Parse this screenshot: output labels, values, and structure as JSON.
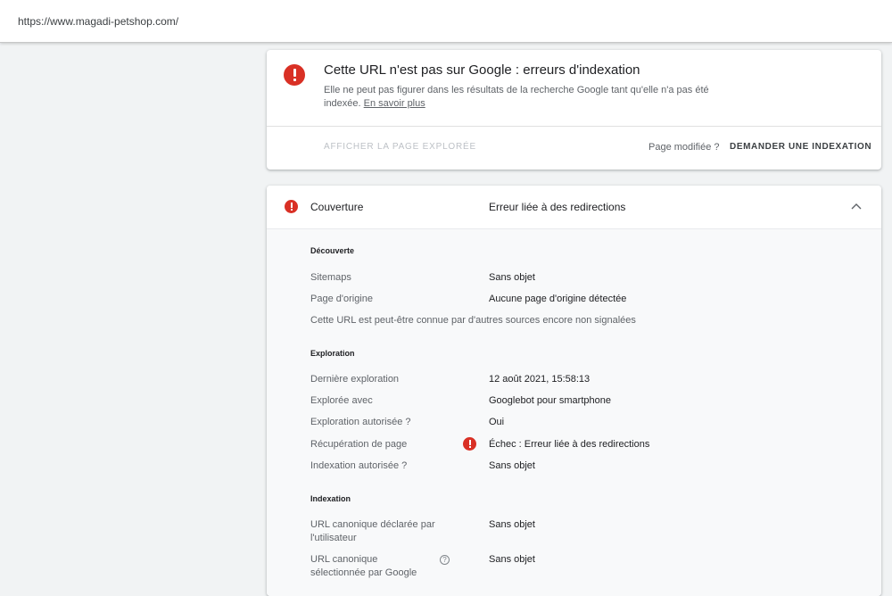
{
  "address_bar": {
    "url": "https://www.magadi-petshop.com/"
  },
  "status_card": {
    "title": "Cette URL n'est pas sur Google : erreurs d'indexation",
    "description": "Elle ne peut pas figurer dans les résultats de la recherche Google tant qu'elle n'a pas été indexée.",
    "learn_more": "En savoir plus",
    "view_crawled_label": "AFFICHER LA PAGE EXPLORÉE",
    "page_modified_question": "Page modifiée ?",
    "request_indexing_label": "DEMANDER UNE INDEXATION"
  },
  "coverage": {
    "label": "Couverture",
    "value": "Erreur liée à des redirections",
    "discovery": {
      "heading": "Découverte",
      "sitemaps_label": "Sitemaps",
      "sitemaps_value": "Sans objet",
      "referring_label": "Page d'origine",
      "referring_value": "Aucune page d'origine détectée",
      "note": "Cette URL est peut-être connue par d'autres sources encore non signalées"
    },
    "crawl": {
      "heading": "Exploration",
      "last_crawl_label": "Dernière exploration",
      "last_crawl_value": "12 août 2021, 15:58:13",
      "crawled_as_label": "Explorée avec",
      "crawled_as_value": "Googlebot pour smartphone",
      "crawl_allowed_label": "Exploration autorisée ?",
      "crawl_allowed_value": "Oui",
      "page_fetch_label": "Récupération de page",
      "page_fetch_value": "Échec : Erreur liée à des redirections",
      "indexing_allowed_label": "Indexation autorisée ?",
      "indexing_allowed_value": "Sans objet"
    },
    "indexing": {
      "heading": "Indexation",
      "user_canonical_label_1": "URL canonique déclarée par",
      "user_canonical_label_2": "l'utilisateur",
      "user_canonical_value": "Sans objet",
      "google_canonical_label_1": "URL canonique",
      "google_canonical_label_2": "sélectionnée par Google",
      "google_canonical_value": "Sans objet"
    }
  },
  "icons": {
    "error": "error-icon",
    "chevron": "chevron-up-icon",
    "help": "help-icon"
  },
  "colors": {
    "error": "#d93025"
  }
}
